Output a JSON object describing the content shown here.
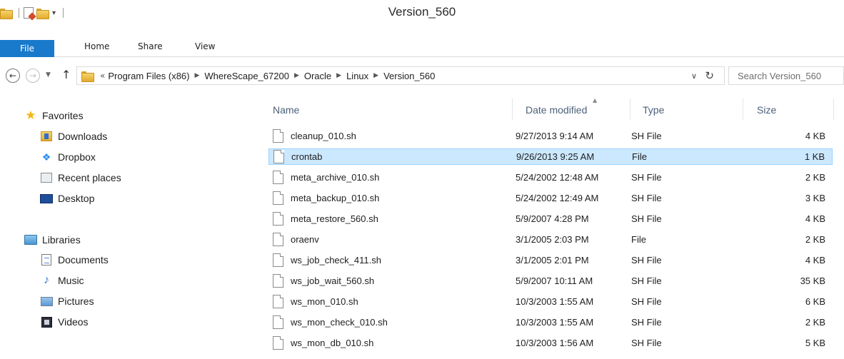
{
  "window": {
    "title": "Version_560"
  },
  "ribbon": {
    "tabs": [
      "File",
      "Home",
      "Share",
      "View"
    ]
  },
  "address": {
    "overflow": "«",
    "breadcrumbs": [
      "Program Files (x86)",
      "WhereScape_67200",
      "Oracle",
      "Linux",
      "Version_560"
    ],
    "search_placeholder": "Search Version_560"
  },
  "nav": {
    "favorites_header": "Favorites",
    "favorites": [
      {
        "label": "Downloads",
        "icon": "downloads-icon"
      },
      {
        "label": "Dropbox",
        "icon": "dropbox-icon"
      },
      {
        "label": "Recent places",
        "icon": "recent-places-icon"
      },
      {
        "label": "Desktop",
        "icon": "desktop-icon"
      }
    ],
    "libraries_header": "Libraries",
    "libraries": [
      {
        "label": "Documents",
        "icon": "documents-icon"
      },
      {
        "label": "Music",
        "icon": "music-icon"
      },
      {
        "label": "Pictures",
        "icon": "pictures-icon"
      },
      {
        "label": "Videos",
        "icon": "videos-icon"
      }
    ]
  },
  "columns": {
    "name": "Name",
    "date": "Date modified",
    "type": "Type",
    "size": "Size"
  },
  "files": [
    {
      "name": "cleanup_010.sh",
      "date": "9/27/2013 9:14 AM",
      "type": "SH File",
      "size": "4 KB",
      "selected": false
    },
    {
      "name": "crontab",
      "date": "9/26/2013 9:25 AM",
      "type": "File",
      "size": "1 KB",
      "selected": true
    },
    {
      "name": "meta_archive_010.sh",
      "date": "5/24/2002 12:48 AM",
      "type": "SH File",
      "size": "2 KB",
      "selected": false
    },
    {
      "name": "meta_backup_010.sh",
      "date": "5/24/2002 12:49 AM",
      "type": "SH File",
      "size": "3 KB",
      "selected": false
    },
    {
      "name": "meta_restore_560.sh",
      "date": "5/9/2007 4:28 PM",
      "type": "SH File",
      "size": "4 KB",
      "selected": false
    },
    {
      "name": "oraenv",
      "date": "3/1/2005 2:03 PM",
      "type": "File",
      "size": "2 KB",
      "selected": false
    },
    {
      "name": "ws_job_check_411.sh",
      "date": "3/1/2005 2:01 PM",
      "type": "SH File",
      "size": "4 KB",
      "selected": false
    },
    {
      "name": "ws_job_wait_560.sh",
      "date": "5/9/2007 10:11 AM",
      "type": "SH File",
      "size": "35 KB",
      "selected": false
    },
    {
      "name": "ws_mon_010.sh",
      "date": "10/3/2003 1:55 AM",
      "type": "SH File",
      "size": "6 KB",
      "selected": false
    },
    {
      "name": "ws_mon_check_010.sh",
      "date": "10/3/2003 1:55 AM",
      "type": "SH File",
      "size": "2 KB",
      "selected": false
    },
    {
      "name": "ws_mon_db_010.sh",
      "date": "10/3/2003 1:56 AM",
      "type": "SH File",
      "size": "5 KB",
      "selected": false
    }
  ],
  "colors": {
    "accent": "#1979ca",
    "selection": "#cce8ff",
    "selection_border": "#99d1ff",
    "header_text": "#4c607a"
  }
}
